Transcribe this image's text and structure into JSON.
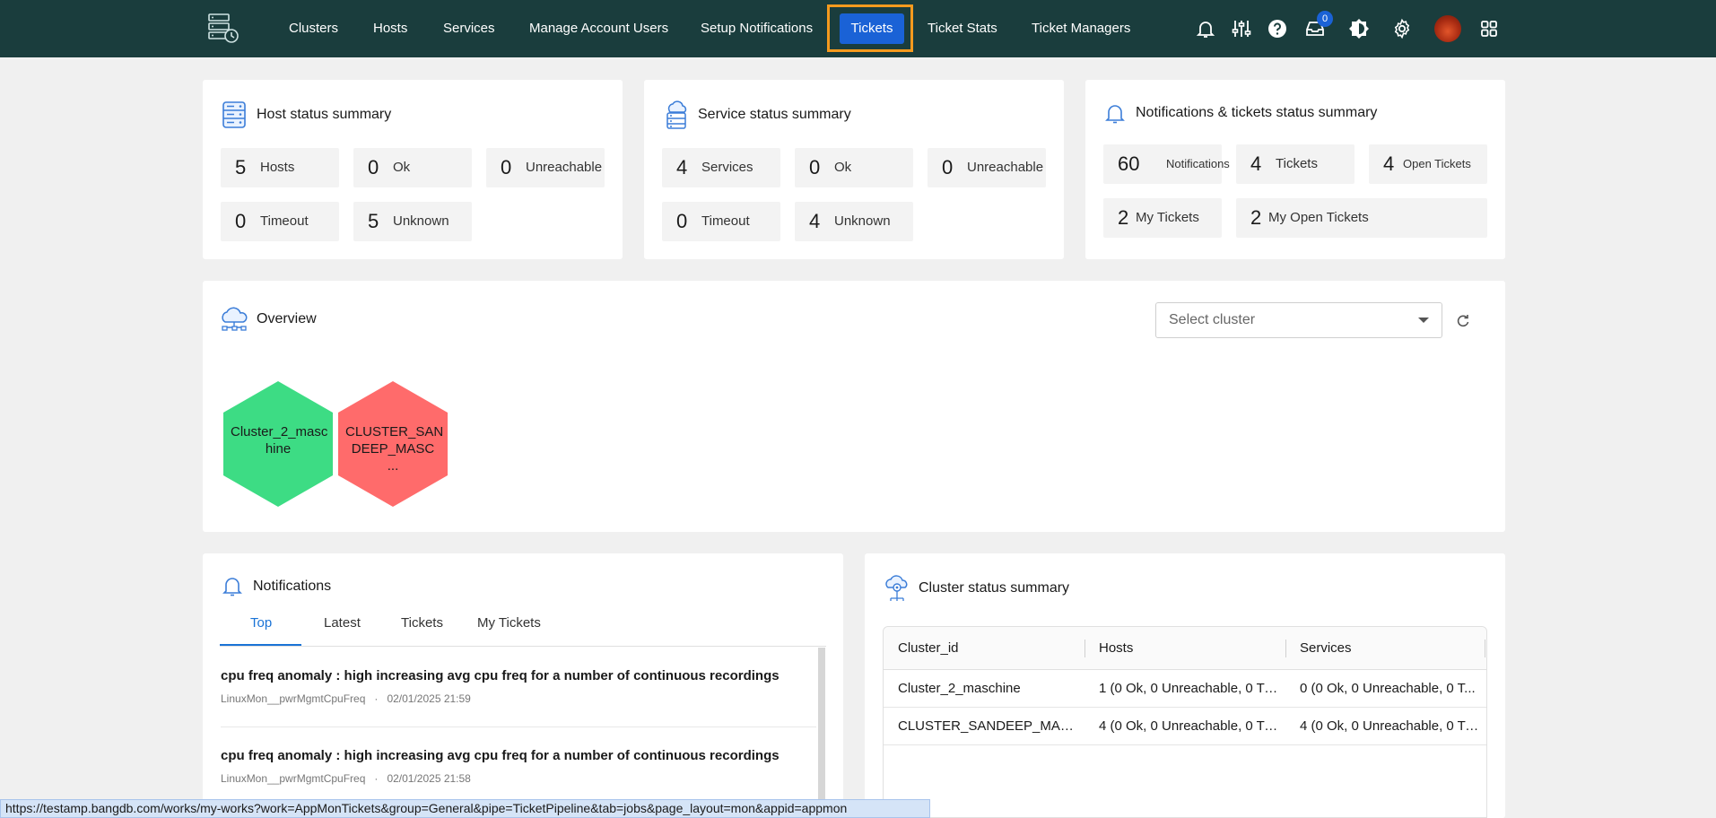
{
  "nav": {
    "items": [
      "Clusters",
      "Hosts",
      "Services",
      "Manage Account Users",
      "Setup Notifications",
      "Tickets",
      "Ticket Stats",
      "Ticket Managers"
    ],
    "active": "Tickets",
    "inbox_count": "0"
  },
  "host_summary": {
    "title": "Host status summary",
    "stats": [
      {
        "value": "5",
        "label": "Hosts"
      },
      {
        "value": "0",
        "label": "Ok"
      },
      {
        "value": "0",
        "label": "Unreachable"
      },
      {
        "value": "0",
        "label": "Timeout"
      },
      {
        "value": "5",
        "label": "Unknown"
      }
    ]
  },
  "service_summary": {
    "title": "Service status summary",
    "stats": [
      {
        "value": "4",
        "label": "Services"
      },
      {
        "value": "0",
        "label": "Ok"
      },
      {
        "value": "0",
        "label": "Unreachable"
      },
      {
        "value": "0",
        "label": "Timeout"
      },
      {
        "value": "4",
        "label": "Unknown"
      }
    ]
  },
  "notif_summary": {
    "title": "Notifications & tickets status summary",
    "stats": [
      {
        "value": "60",
        "label": "Notifications"
      },
      {
        "value": "4",
        "label": "Tickets"
      },
      {
        "value": "4",
        "label": "Open Tickets"
      },
      {
        "value": "2",
        "label": "My Tickets"
      },
      {
        "value": "2",
        "label": "My Open Tickets"
      }
    ]
  },
  "overview": {
    "title": "Overview",
    "select_placeholder": "Select cluster",
    "clusters": [
      {
        "label": "Cluster_2_maschine",
        "display": "Cluster_2_masc hine",
        "color": "#3ddc84"
      },
      {
        "label": "CLUSTER_SANDEEP_MASC",
        "display": "CLUSTER_SAN DEEP_MASC ...",
        "color": "#ff6b6b"
      }
    ]
  },
  "notifications": {
    "title": "Notifications",
    "tabs": [
      "Top",
      "Latest",
      "Tickets",
      "My Tickets"
    ],
    "active_tab": "Top",
    "items": [
      {
        "title": "cpu freq anomaly : high increasing avg cpu freq for a number of continuous recordings",
        "source": "LinuxMon__pwrMgmtCpuFreq",
        "time": "02/01/2025 21:59"
      },
      {
        "title": "cpu freq anomaly : high increasing avg cpu freq for a number of continuous recordings",
        "source": "LinuxMon__pwrMgmtCpuFreq",
        "time": "02/01/2025 21:58"
      }
    ]
  },
  "cluster_summary": {
    "title": "Cluster status summary",
    "columns": [
      "Cluster_id",
      "Hosts",
      "Services"
    ],
    "rows": [
      [
        "Cluster_2_maschine",
        "1 (0 Ok, 0 Unreachable, 0 Ti...",
        "0 (0 Ok, 0 Unreachable, 0 T..."
      ],
      [
        "CLUSTER_SANDEEP_MASC...",
        "4 (0 Ok, 0 Unreachable, 0 Ti...",
        "4 (0 Ok, 0 Unreachable, 0 Ti..."
      ]
    ]
  },
  "status_url": "https://testamp.bangdb.com/works/my-works?work=AppMonTickets&group=General&pipe=TicketPipeline&tab=jobs&page_layout=mon&appid=appmon",
  "colors": {
    "nav_bg": "#1a3d3d",
    "accent": "#1a62d6",
    "highlight": "#f59a1e"
  }
}
